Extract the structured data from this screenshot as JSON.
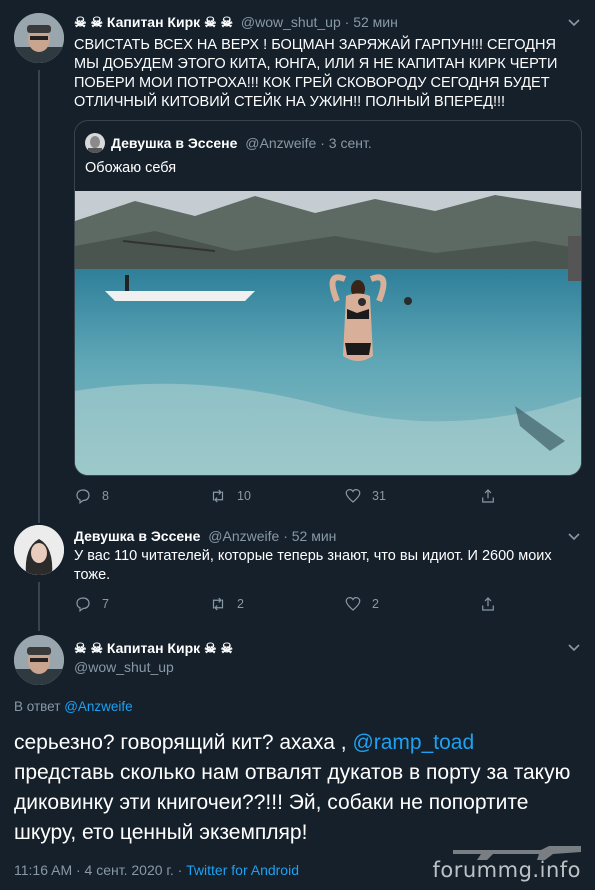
{
  "tweet1": {
    "author_name": "☠ ☠ Капитан Кирк ☠ ☠",
    "handle": "@wow_shut_up",
    "time": "52 мин",
    "text": "СВИСТАТЬ ВСЕХ НА ВЕРХ ! БОЦМАН ЗАРЯЖАЙ ГАРПУН!!! СЕГОДНЯ МЫ ДОБУДЕМ ЭТОГО КИТА, ЮНГА, ИЛИ Я НЕ КАПИТАН КИРК ЧЕРТИ ПОБЕРИ МОИ ПОТРОХА!!! КОК ГРЕЙ СКОВОРОДУ СЕГОДНЯ БУДЕТ ОТЛИЧНЫЙ КИТОВИЙ СТЕЙК НА УЖИН!! ПОЛНЫЙ ВПЕРЕД!!!",
    "quote": {
      "author_name": "Девушка в Эссене",
      "handle": "@Anzweife",
      "time": "3 сент.",
      "text": "Обожаю себя"
    },
    "replies": "8",
    "retweets": "10",
    "likes": "31"
  },
  "tweet2": {
    "author_name": "Девушка в Эссене",
    "handle": "@Anzweife",
    "time": "52 мин",
    "text": "У вас 110 читателей, которые теперь знают, что вы идиот. И 2600 моих тоже.",
    "replies": "7",
    "retweets": "2",
    "likes": "2"
  },
  "tweet3": {
    "author_name": "☠ ☠ Капитан Кирк ☠ ☠",
    "handle": "@wow_shut_up",
    "reply_prefix": "В ответ",
    "reply_to": "@Anzweife",
    "text_part1": "серьезно? говорящий кит? ахаха ,",
    "mention": "@ramp_toad",
    "text_part2": "представь сколько нам отвалят дукатов в порту за такую диковинку эти книгочеи??!!! Эй, собаки не попортите шкуру, ето ценный экземпляр!",
    "footer_time": "11:16 AM · 4 сент. 2020 г. ·",
    "footer_source": "Twitter for Android"
  },
  "watermark": "forummg.info",
  "colors": {
    "background": "#15202b",
    "accent": "#1da1f2",
    "secondary": "#8899a6",
    "border": "#38444d"
  }
}
